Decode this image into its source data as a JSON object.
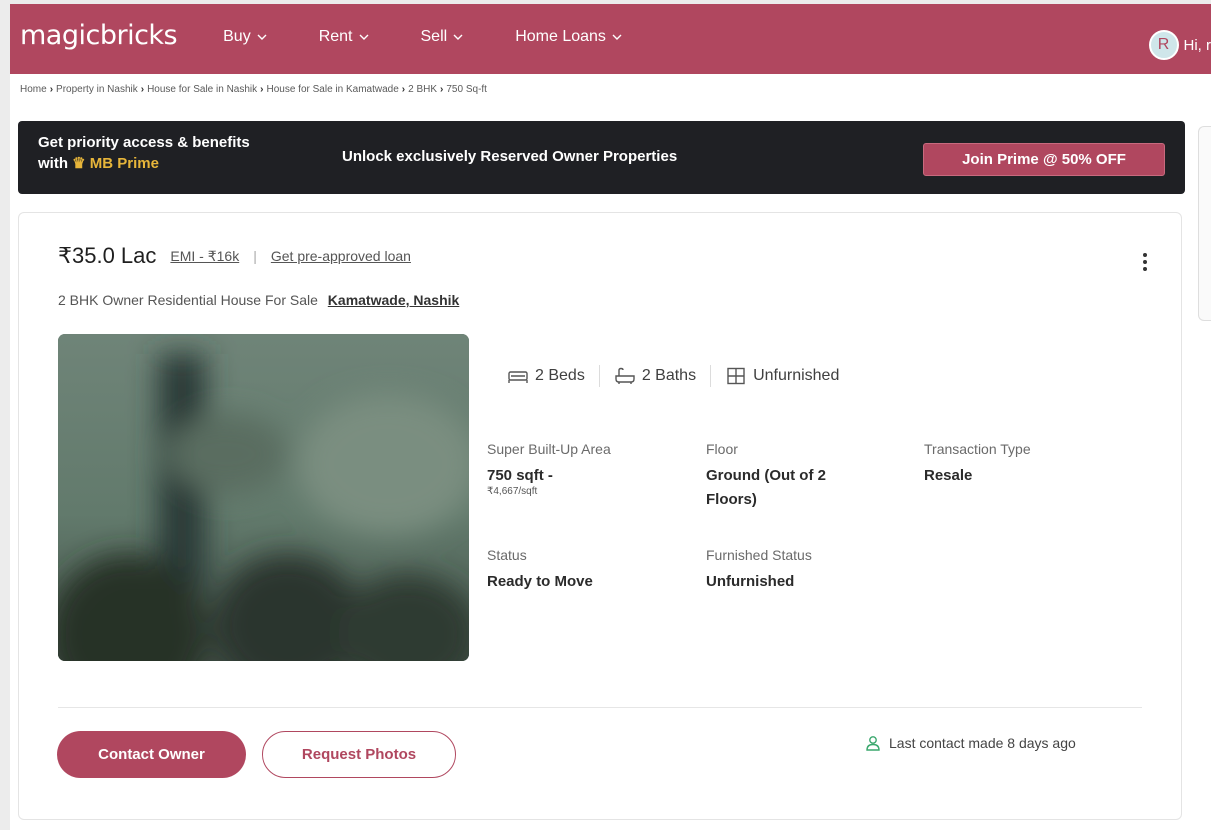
{
  "header": {
    "logo": "magicbricks",
    "nav": [
      {
        "label": "Buy"
      },
      {
        "label": "Rent"
      },
      {
        "label": "Sell"
      },
      {
        "label": "Home Loans"
      }
    ],
    "user_initial": "R",
    "user_greeting": "Hi, r"
  },
  "breadcrumb": [
    "Home",
    "Property in Nashik",
    "House for Sale in Nashik",
    "House for Sale in Kamatwade",
    "2 BHK",
    "750 Sq-ft"
  ],
  "banner": {
    "line1": "Get priority access & benefits",
    "line2_prefix": "with",
    "prime_label": "MB Prime",
    "middle": "Unlock exclusively Reserved Owner Properties",
    "cta": "Join Prime @ 50% OFF"
  },
  "listing": {
    "price": "₹35.0 Lac",
    "emi": "EMI - ₹16k",
    "separator": "|",
    "loan_link": "Get pre-approved loan",
    "title": "2 BHK Owner Residential House For Sale",
    "location": "Kamatwade, Nashik",
    "amenities": [
      {
        "icon": "bed-icon",
        "label": "2 Beds"
      },
      {
        "icon": "bath-icon",
        "label": "2 Baths"
      },
      {
        "icon": "furnish-icon",
        "label": "Unfurnished"
      }
    ],
    "summary": {
      "super_area_label": "Super Built-Up Area",
      "super_area_value": "750 sqft -",
      "price_per_sqft": "₹4,667/sqft",
      "floor_label": "Floor",
      "floor_value": "Ground (Out of 2 Floors)",
      "transaction_label": "Transaction Type",
      "transaction_value": "Resale",
      "status_label": "Status",
      "status_value": "Ready to Move",
      "furnished_label": "Furnished Status",
      "furnished_value": "Unfurnished"
    },
    "contact_button": "Contact Owner",
    "photos_button": "Request Photos",
    "last_contact": "Last contact made 8 days ago"
  },
  "colors": {
    "brand": "#b0475f",
    "banner_bg": "#1f2024",
    "prime_gold": "#e7b53a",
    "contact_green": "#3aa76d"
  }
}
